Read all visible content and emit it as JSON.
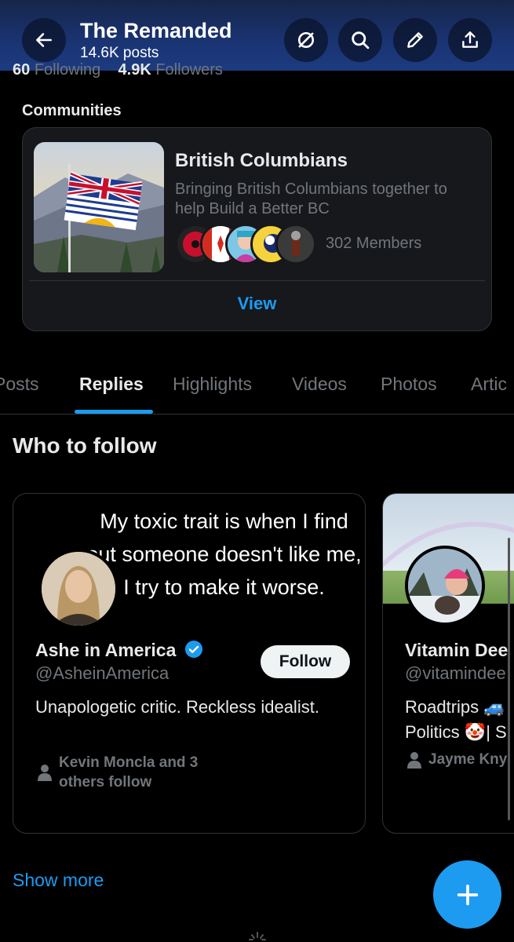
{
  "header": {
    "title": "The Remanded",
    "posts_count": "14.6K posts",
    "back_icon": "arrow-left-icon",
    "grok_icon": "grok-icon",
    "search_icon": "search-icon",
    "edit_icon": "pencil-icon",
    "share_icon": "share-icon",
    "background": "#1a3473"
  },
  "stats": {
    "following_count": "60",
    "following_label": "Following",
    "followers_count": "4.9K",
    "followers_label": "Followers"
  },
  "communities": {
    "label": "Communities",
    "card": {
      "name": "British Columbians",
      "description": "Bringing British Columbians together to help Build a Better BC",
      "members": "302 Members",
      "view_label": "View"
    }
  },
  "tabs": [
    {
      "label": "Posts",
      "active": false
    },
    {
      "label": "Replies",
      "active": true
    },
    {
      "label": "Highlights",
      "active": false
    },
    {
      "label": "Videos",
      "active": false
    },
    {
      "label": "Photos",
      "active": false
    },
    {
      "label": "Artic",
      "active": false
    }
  ],
  "who_to_follow": {
    "title": "Who to follow",
    "cards": [
      {
        "banner_text": "My toxic trait is when I find out someone doesn't like me, I try to make it worse.",
        "name": "Ashe in America",
        "verified": true,
        "handle": "@AsheinAmerica",
        "follow_label": "Follow",
        "bio": "Unapologetic critic. Reckless idealist.",
        "followed_by": "Kevin Moncla and 3 others follow"
      },
      {
        "name": "Vitamin Dee",
        "handle": "@vitamindee",
        "bio_line1": "Roadtrips 🚙",
        "bio_line2": "Politics 🤡| S",
        "followed_by": "Jayme Kny"
      }
    ],
    "show_more": "Show more"
  },
  "fab": {
    "icon": "plus-icon"
  },
  "colors": {
    "accent": "#1d9bf0",
    "muted": "#71767b",
    "text": "#e7e9ea",
    "card_bg": "#16181c",
    "border": "#2f3336"
  }
}
